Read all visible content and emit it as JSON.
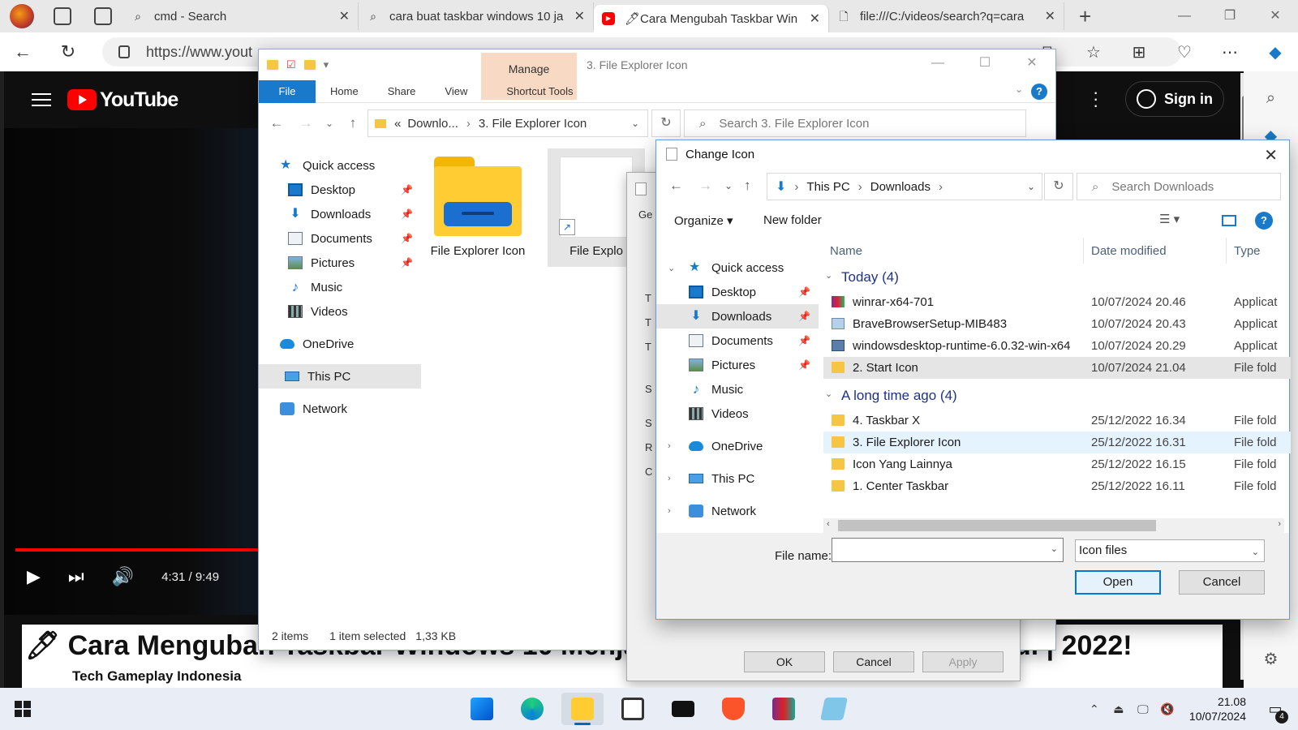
{
  "browser": {
    "tabs": [
      {
        "label": "cmd - Search",
        "icon": "search-icon",
        "active": false
      },
      {
        "label": "cara buat taskbar windows 10 ja",
        "icon": "search-icon",
        "active": false
      },
      {
        "label": "🖊Cara Mengubah Taskbar Win",
        "icon": "youtube-icon",
        "active": true
      },
      {
        "label": "file:///C:/videos/search?q=cara",
        "icon": "file-icon",
        "active": false
      }
    ],
    "address": "https://www.yout",
    "new_tab": "+"
  },
  "youtube": {
    "logo_text": "YouTube",
    "sign_in": "Sign in",
    "time": "4:31 / 9:49",
    "title": "Cara Mengubah Taskbar Windows 10 Menjadi Seperti Windows 11 Ketahui | 2022!",
    "channel": "Tech Gameplay Indonesia"
  },
  "explorer": {
    "title": "3. File Explorer Icon",
    "manage_label": "Manage",
    "ribbon_tabs": [
      "File",
      "Home",
      "Share",
      "View",
      "Shortcut Tools"
    ],
    "crumb": {
      "root": "Downlo...",
      "current": "3. File Explorer Icon"
    },
    "search_placeholder": "Search 3. File Explorer Icon",
    "nav": [
      {
        "label": "Quick access",
        "icon": "star-icon",
        "pinned": false
      },
      {
        "label": "Desktop",
        "icon": "desktop-icon",
        "pinned": true
      },
      {
        "label": "Downloads",
        "icon": "download-icon",
        "pinned": true
      },
      {
        "label": "Documents",
        "icon": "documents-icon",
        "pinned": true
      },
      {
        "label": "Pictures",
        "icon": "pictures-icon",
        "pinned": true
      },
      {
        "label": "Music",
        "icon": "music-icon",
        "pinned": false
      },
      {
        "label": "Videos",
        "icon": "videos-icon",
        "pinned": false
      },
      {
        "label": "OneDrive",
        "icon": "cloud-icon",
        "pinned": false
      },
      {
        "label": "This PC",
        "icon": "pc-icon",
        "pinned": false
      },
      {
        "label": "Network",
        "icon": "network-icon",
        "pinned": false
      }
    ],
    "items": [
      {
        "label": "File Explorer Icon",
        "kind": "icon"
      },
      {
        "label": "File Explo",
        "kind": "shortcut"
      }
    ],
    "status": {
      "count": "2 items",
      "selected": "1 item selected",
      "size": "1,33 KB"
    }
  },
  "properties": {
    "tab": "Ge",
    "labels": [
      "T",
      "T",
      "T",
      "S",
      "S",
      "R",
      "C"
    ],
    "buttons": {
      "ok": "OK",
      "cancel": "Cancel",
      "apply": "Apply"
    }
  },
  "dialog": {
    "title": "Change Icon",
    "crumb": {
      "a": "This PC",
      "b": "Downloads"
    },
    "search_placeholder": "Search Downloads",
    "organize": "Organize ▾",
    "new_folder": "New folder",
    "columns": {
      "name": "Name",
      "date": "Date modified",
      "type": "Type"
    },
    "nav": [
      {
        "label": "Quick access",
        "icon": "star-icon",
        "expand": "⌄",
        "pinned": false
      },
      {
        "label": "Desktop",
        "icon": "desktop-icon",
        "expand": "",
        "pinned": true
      },
      {
        "label": "Downloads",
        "icon": "download-icon",
        "expand": "",
        "pinned": true
      },
      {
        "label": "Documents",
        "icon": "documents-icon",
        "expand": "",
        "pinned": true
      },
      {
        "label": "Pictures",
        "icon": "pictures-icon",
        "expand": "",
        "pinned": true
      },
      {
        "label": "Music",
        "icon": "music-icon",
        "expand": "",
        "pinned": false
      },
      {
        "label": "Videos",
        "icon": "videos-icon",
        "expand": "",
        "pinned": false
      },
      {
        "label": "OneDrive",
        "icon": "cloud-icon",
        "expand": "›",
        "pinned": false
      },
      {
        "label": "This PC",
        "icon": "pc-icon",
        "expand": "›",
        "pinned": false
      },
      {
        "label": "Network",
        "icon": "network-icon",
        "expand": "›",
        "pinned": false
      }
    ],
    "groups": [
      {
        "label": "Today (4)",
        "rows": [
          {
            "name": "winrar-x64-701",
            "date": "10/07/2024 20.46",
            "type": "Applicat",
            "icon": "app1"
          },
          {
            "name": "BraveBrowserSetup-MIB483",
            "date": "10/07/2024 20.43",
            "type": "Applicat",
            "icon": "app2"
          },
          {
            "name": "windowsdesktop-runtime-6.0.32-win-x64",
            "date": "10/07/2024 20.29",
            "type": "Applicat",
            "icon": "app3"
          },
          {
            "name": "2. Start Icon",
            "date": "10/07/2024 21.04",
            "type": "File fold",
            "icon": "folder"
          }
        ]
      },
      {
        "label": "A long time ago (4)",
        "rows": [
          {
            "name": "4. Taskbar X",
            "date": "25/12/2022 16.34",
            "type": "File fold",
            "icon": "folder"
          },
          {
            "name": "3. File Explorer Icon",
            "date": "25/12/2022 16.31",
            "type": "File fold",
            "icon": "folder"
          },
          {
            "name": "Icon Yang Lainnya",
            "date": "25/12/2022 16.15",
            "type": "File fold",
            "icon": "folder"
          },
          {
            "name": "1. Center Taskbar",
            "date": "25/12/2022 16.11",
            "type": "File fold",
            "icon": "folder"
          }
        ]
      }
    ],
    "file_name_label": "File name:",
    "file_name_value": "",
    "file_type": "Icon files",
    "open": "Open",
    "cancel": "Cancel"
  },
  "taskbar": {
    "time": "21.08",
    "date": "10/07/2024",
    "notifications": "4"
  }
}
